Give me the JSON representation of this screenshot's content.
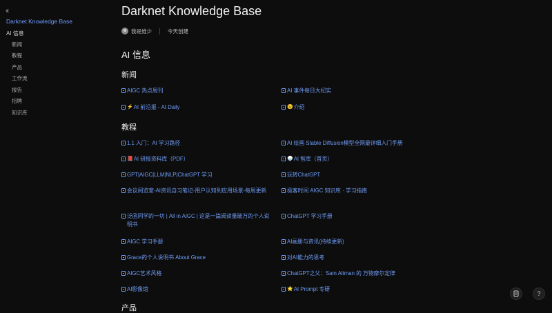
{
  "sidebar": {
    "collapse_icon": "double-chevron-left-icon",
    "kb_title": "Darknet Knowledge Base",
    "group_label": "AI 信息",
    "items": [
      {
        "label": "新闻"
      },
      {
        "label": "教程"
      },
      {
        "label": "产品"
      },
      {
        "label": "工作流"
      },
      {
        "label": "报告"
      },
      {
        "label": "招聘"
      },
      {
        "label": "知识库"
      }
    ]
  },
  "header": {
    "title": "Darknet Knowledge Base",
    "author": "我是维少",
    "created": "今天创建"
  },
  "content": {
    "h1": "AI 信息",
    "news": {
      "heading": "新闻",
      "links": [
        {
          "text": "AIGC 热点周刊"
        },
        {
          "text": "AI 事件每日大纪实"
        },
        {
          "emoji": "⚡",
          "text": "AI 前沿报 - AI Daily"
        },
        {
          "emoji": "😉",
          "text": "介绍"
        }
      ]
    },
    "tutorial": {
      "heading": "教程",
      "links": [
        {
          "text": "1.1 入门：AI 学习路径"
        },
        {
          "text": "AI 绘画 Stable Diffusion模型全网最详细入门手册"
        },
        {
          "emoji": "📕",
          "text": "AI 研报资料库（PDF）"
        },
        {
          "emoji": "🍚",
          "text": "AI 智库（首页）"
        },
        {
          "text": "GPT|AIGC|LLM|NLP|ChatGPT 学习"
        },
        {
          "text": "玩转ChatGPT"
        },
        {
          "text": "会议阅览室-AI资讯自习笔记-用户认知到应用场景-每周更新"
        },
        {
          "text": "极客时间 AIGC 知识库 · 学习指南"
        },
        {
          "text": "泛函同学的一切 | All in AIGC | 这是一篇阅读量破万的个人说明书"
        },
        {
          "text": "ChatGPT 学习手册"
        },
        {
          "text": "AIGC 学习手册"
        },
        {
          "text": "AI画册与资讯(持续更新)"
        },
        {
          "text": "Grace的个人说明书 About Grace"
        },
        {
          "text": "对AI能力的思考"
        },
        {
          "text": "AIGC艺术风格"
        },
        {
          "text": "ChatGPT之父：Sam Altman 的 万物摩尔定律"
        },
        {
          "text": "AI影像馆"
        },
        {
          "emoji": "⭐",
          "text": "AI Prompt 专研"
        }
      ]
    },
    "product_heading": "产品"
  },
  "fabs": {
    "left_icon": "document-icon",
    "right_icon": "help-icon",
    "right_glyph": "?"
  }
}
